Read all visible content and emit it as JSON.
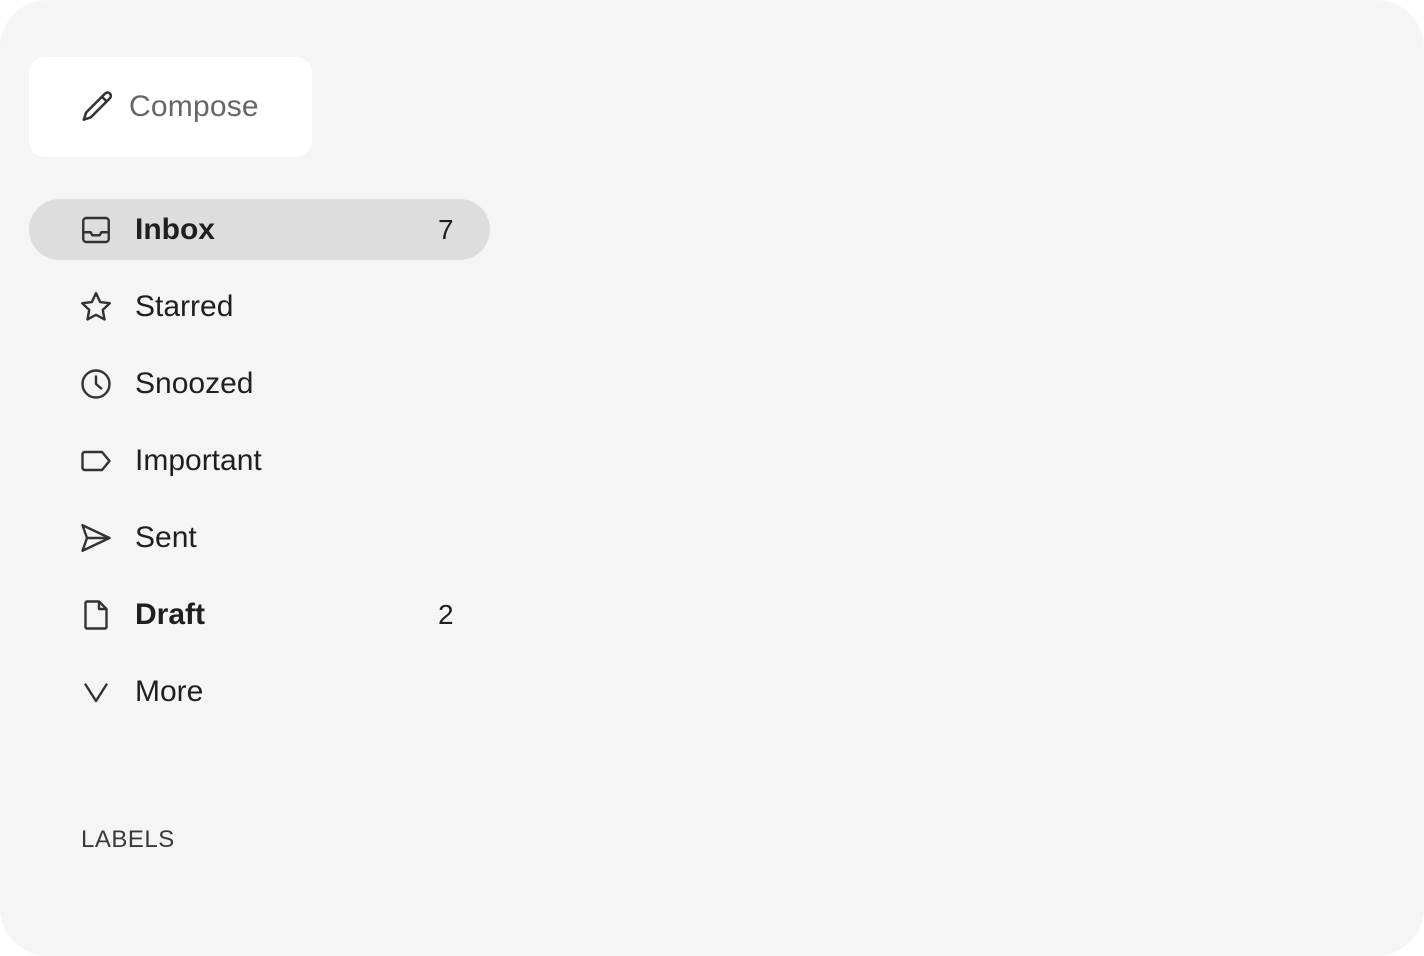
{
  "compose": {
    "label": "Compose",
    "icon": "pencil-icon"
  },
  "nav": {
    "items": [
      {
        "label": "Inbox",
        "icon": "inbox-icon",
        "count": "7",
        "active": true,
        "bold": true
      },
      {
        "label": "Starred",
        "icon": "star-icon",
        "count": "",
        "active": false,
        "bold": false
      },
      {
        "label": "Snoozed",
        "icon": "clock-icon",
        "count": "",
        "active": false,
        "bold": false
      },
      {
        "label": "Important",
        "icon": "label-tag-icon",
        "count": "",
        "active": false,
        "bold": false
      },
      {
        "label": "Sent",
        "icon": "send-icon",
        "count": "",
        "active": false,
        "bold": false
      },
      {
        "label": "Draft",
        "icon": "file-icon",
        "count": "2",
        "active": false,
        "bold": true
      },
      {
        "label": "More",
        "icon": "chevron-down-icon",
        "count": "",
        "active": false,
        "bold": false
      }
    ]
  },
  "labels": {
    "heading": "LABELS"
  },
  "colors": {
    "panel_background": "#f5f5f5",
    "active_background": "#dddddd",
    "compose_background": "#ffffff",
    "text": "#1f1f1f",
    "muted_text": "#666666"
  }
}
